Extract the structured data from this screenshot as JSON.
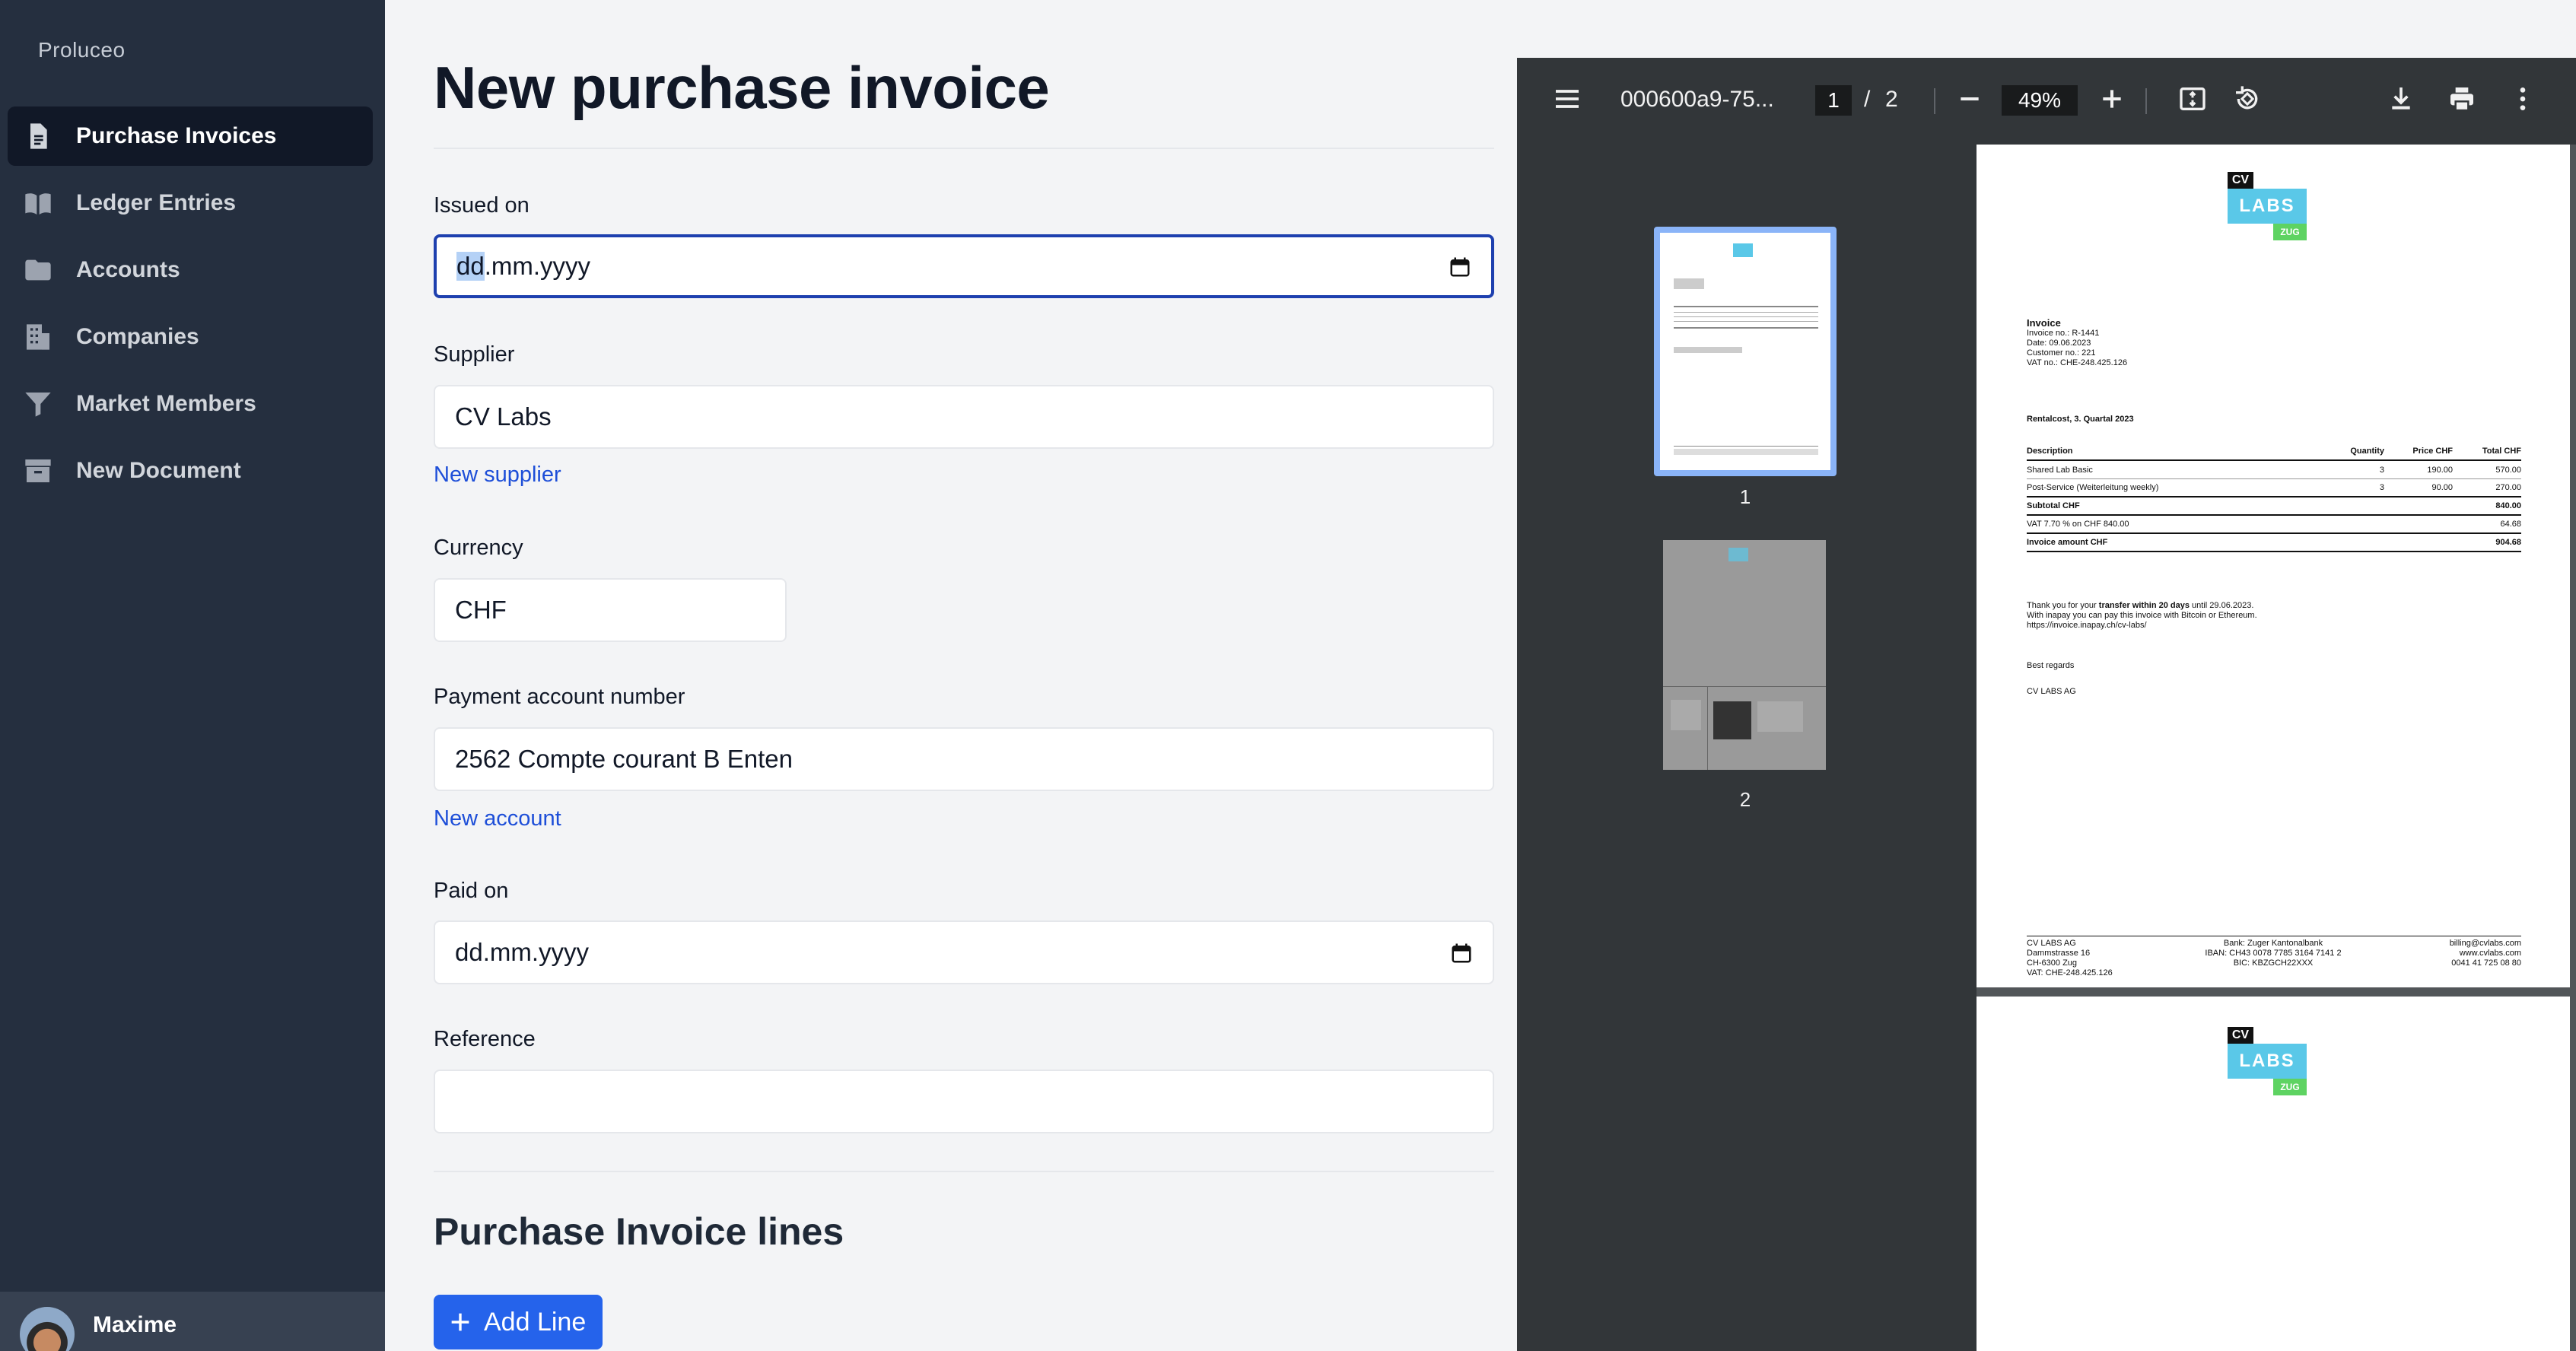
{
  "sidebar": {
    "brand": "Proluceo",
    "items": [
      {
        "label": "Purchase Invoices",
        "icon": "document-icon",
        "active": true
      },
      {
        "label": "Ledger Entries",
        "icon": "book-icon"
      },
      {
        "label": "Accounts",
        "icon": "folder-icon"
      },
      {
        "label": "Companies",
        "icon": "building-icon"
      },
      {
        "label": "Market Members",
        "icon": "funnel-icon"
      },
      {
        "label": "New Document",
        "icon": "archive-icon"
      }
    ],
    "user": {
      "name": "Maxime"
    }
  },
  "form": {
    "title": "New purchase invoice",
    "issued_on": {
      "label": "Issued on",
      "value_sel": "dd",
      "value_rest": ".mm.yyyy"
    },
    "supplier": {
      "label": "Supplier",
      "value": "CV Labs",
      "new_link": "New supplier"
    },
    "currency": {
      "label": "Currency",
      "value": "CHF"
    },
    "payment_account": {
      "label": "Payment account number",
      "value": "2562 Compte courant B Enten",
      "new_link": "New account"
    },
    "paid_on": {
      "label": "Paid on",
      "value": "dd.mm.yyyy"
    },
    "reference": {
      "label": "Reference",
      "value": ""
    },
    "lines_title": "Purchase Invoice lines",
    "add_line": "Add Line"
  },
  "pdf": {
    "title": "000600a9-75...",
    "page_current": "1",
    "page_sep": "/",
    "page_total": "2",
    "zoom": "49%",
    "thumbs": [
      "1",
      "2"
    ],
    "document": {
      "logo": {
        "cv": "CV",
        "labs": "LABS",
        "zug": "ZUG"
      },
      "heading": "Invoice",
      "meta": [
        "Invoice no.: R-1441",
        "Date: 09.06.2023",
        "Customer no.: 221",
        "VAT no.: CHE-248.425.126"
      ],
      "subject": "Rentalcost, 3. Quartal 2023",
      "table": {
        "headers": [
          "Description",
          "Quantity",
          "Price CHF",
          "Total CHF"
        ],
        "rows": [
          [
            "Shared Lab Basic",
            "3",
            "190.00",
            "570.00"
          ],
          [
            "Post-Service (Weiterleitung weekly)",
            "3",
            "90.00",
            "270.00"
          ]
        ],
        "subtotal": [
          "Subtotal CHF",
          "840.00"
        ],
        "vat": [
          "VAT 7.70 % on CHF 840.00",
          "64.68"
        ],
        "total": [
          "Invoice amount CHF",
          "904.68"
        ]
      },
      "thanks_pre": "Thank you for your ",
      "thanks_bold": "transfer within 20 days",
      "thanks_post": " until 29.06.2023.",
      "thanks_line2": "With inapay you can pay this invoice with Bitcoin or Ethereum.",
      "thanks_line3": "https://invoice.inapay.ch/cv-labs/",
      "regards": "Best regards",
      "company": "CV LABS AG",
      "footer_left": [
        "CV LABS AG",
        "Dammstrasse 16",
        "CH-6300 Zug",
        "VAT: CHE-248.425.126"
      ],
      "footer_mid": [
        "Bank: Zuger Kantonalbank",
        "IBAN: CH43 0078 7785 3164 7141 2",
        "BIC: KBZGCH22XXX"
      ],
      "footer_right": [
        "billing@cvlabs.com",
        "www.cvlabs.com",
        "0041 41 725 08 80"
      ]
    }
  }
}
